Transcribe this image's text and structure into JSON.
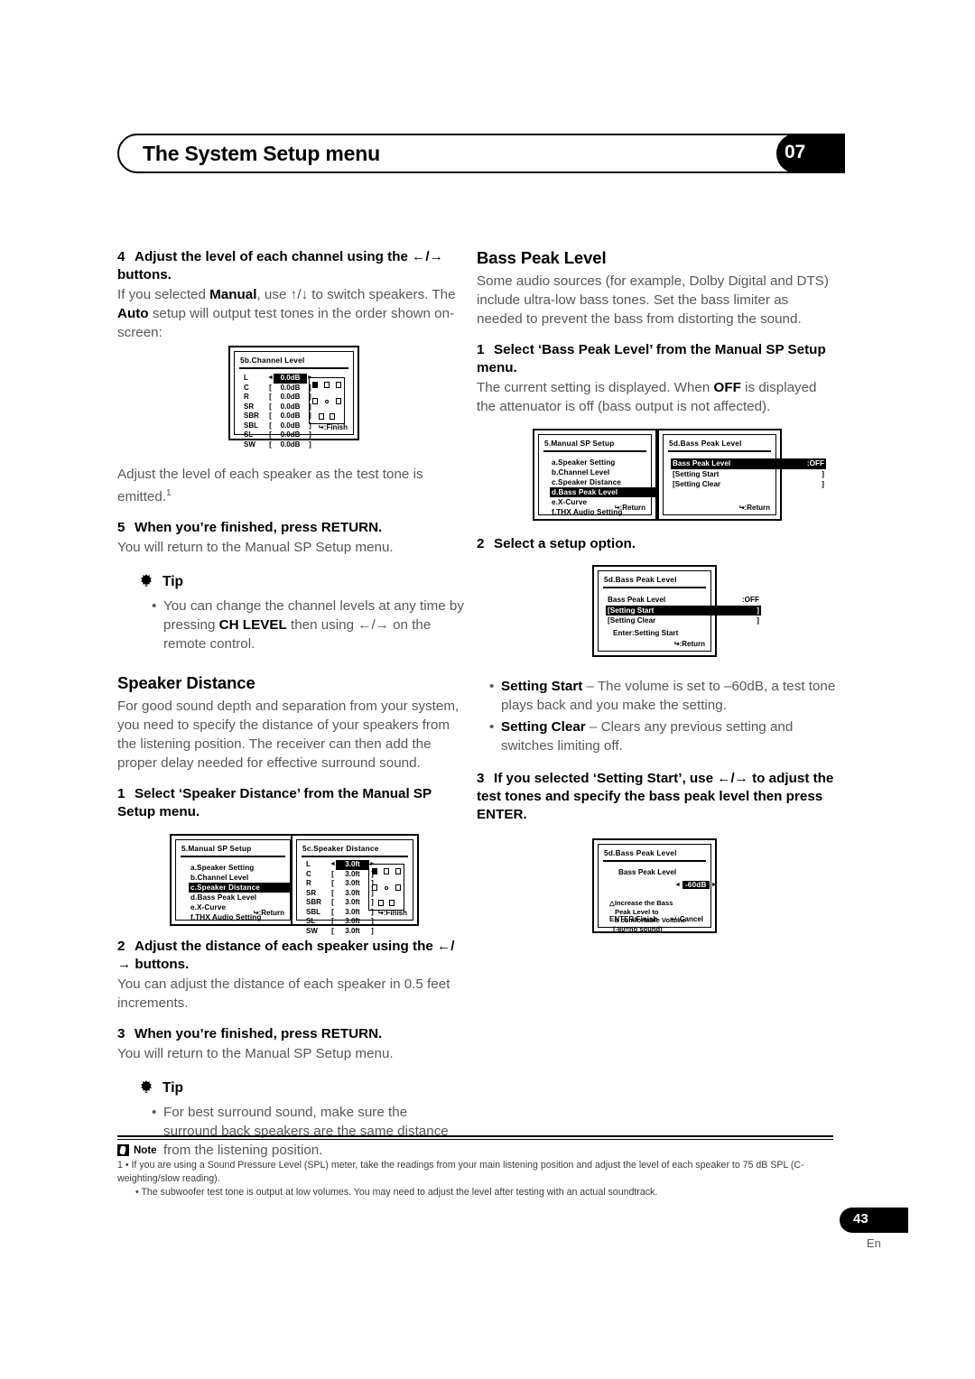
{
  "header": {
    "title": "The System Setup menu",
    "chapter": "07"
  },
  "left_column": {
    "step4": {
      "num": "4",
      "title": "Adjust the level of each channel using the ←/→ buttons.",
      "body_1": "If you selected ",
      "body_manual": "Manual",
      "body_2": ", use ↑/↓ to switch speakers. The ",
      "body_auto": "Auto",
      "body_3": " setup will output test tones in the order shown on-screen:"
    },
    "after_osd_text": "Adjust the level of each speaker as the test tone is emitted.",
    "after_osd_footnote": "1",
    "step5": {
      "num": "5",
      "title": "When you’re finished, press RETURN.",
      "body": "You will return to the Manual SP Setup menu."
    },
    "tip1": {
      "title": "Tip",
      "bullet_a": "You can change the channel levels at any time by pressing ",
      "bullet_b": "CH LEVEL",
      "bullet_c": " then using ←/→ on the remote control."
    },
    "speaker_distance": {
      "heading": "Speaker Distance",
      "body": "For good sound depth and separation from your system, you need to specify the distance of your speakers from the listening position. The receiver can then add the proper delay needed for effective surround sound.",
      "step1_num": "1",
      "step1_title": "Select ‘Speaker Distance’ from the Manual SP Setup menu.",
      "step2_num": "2",
      "step2_title": "Adjust the distance of each speaker using the ←/→ buttons.",
      "step2_body": "You can adjust the distance of each speaker in 0.5 feet increments.",
      "step3_num": "3",
      "step3_title": "When you’re finished, press RETURN.",
      "step3_body": "You will return to the Manual SP Setup menu."
    },
    "tip2": {
      "title": "Tip",
      "bullet": "For best surround sound, make sure the surround back speakers are the same distance from the listening position."
    }
  },
  "right_column": {
    "bass_peak_level": {
      "heading": "Bass Peak Level",
      "body": "Some audio sources (for example, Dolby Digital and DTS) include ultra-low bass tones. Set the bass limiter as needed to prevent the bass from distorting the sound.",
      "step1_num": "1",
      "step1_title": "Select ‘Bass Peak Level’ from the Manual SP Setup menu.",
      "step1_body_a": "The current setting is displayed. When ",
      "step1_body_off": "OFF",
      "step1_body_b": " is displayed the attenuator is off (bass output is not affected).",
      "step2_num": "2",
      "step2_title": "Select a setup option.",
      "bullet_setting_start_k": "Setting Start",
      "bullet_setting_start_t": " – The volume is set to –60dB, a test tone plays back and you make the setting.",
      "bullet_setting_clear_k": "Setting Clear",
      "bullet_setting_clear_t": " – Clears any previous setting and switches limiting off.",
      "step3_num": "3",
      "step3_title": "If you selected ‘Setting Start’, use ←/→ to adjust the test tones and specify the bass peak level then press ENTER."
    }
  },
  "osd_channel_level": {
    "title": "5b.Channel  Level",
    "footer": ":Finish",
    "channels": [
      {
        "name": "L",
        "value": "0.0dB",
        "selected": true
      },
      {
        "name": "C",
        "value": "0.0dB",
        "selected": false
      },
      {
        "name": "R",
        "value": "0.0dB",
        "selected": false
      },
      {
        "name": "SR",
        "value": "0.0dB",
        "selected": false
      },
      {
        "name": "SBR",
        "value": "0.0dB",
        "selected": false
      },
      {
        "name": "SBL",
        "value": "0.0dB",
        "selected": false
      },
      {
        "name": "SL",
        "value": "0.0dB",
        "selected": false
      },
      {
        "name": "SW",
        "value": "0.0dB",
        "selected": false
      }
    ]
  },
  "osd_manual_sp_setup_a": {
    "title": "5.Manual  SP  Setup",
    "footer": ":Return",
    "items": [
      {
        "label": "a.Speaker  Setting",
        "selected": false
      },
      {
        "label": "b.Channel  Level",
        "selected": false
      },
      {
        "label": "c.Speaker  Distance",
        "selected": true
      },
      {
        "label": "d.Bass  Peak  Level",
        "selected": false
      },
      {
        "label": "e.X-Curve",
        "selected": false
      },
      {
        "label": "f.THX  Audio  Setting",
        "selected": false
      }
    ]
  },
  "osd_speaker_distance": {
    "title": "5c.Speaker  Distance",
    "footer": ":Finish",
    "channels": [
      {
        "name": "L",
        "value": "3.0ft",
        "selected": true
      },
      {
        "name": "C",
        "value": "3.0ft",
        "selected": false
      },
      {
        "name": "R",
        "value": "3.0ft",
        "selected": false
      },
      {
        "name": "SR",
        "value": "3.0ft",
        "selected": false
      },
      {
        "name": "SBR",
        "value": "3.0ft",
        "selected": false
      },
      {
        "name": "SBL",
        "value": "3.0ft",
        "selected": false
      },
      {
        "name": "SL",
        "value": "3.0ft",
        "selected": false
      },
      {
        "name": "SW",
        "value": "3.0ft",
        "selected": false
      }
    ]
  },
  "osd_manual_sp_setup_b": {
    "title": "5.Manual  SP  Setup",
    "footer": ":Return",
    "items": [
      {
        "label": "a.Speaker  Setting",
        "selected": false
      },
      {
        "label": "b.Channel  Level",
        "selected": false
      },
      {
        "label": "c.Speaker  Distance",
        "selected": false
      },
      {
        "label": "d.Bass  Peak  Level",
        "selected": true
      },
      {
        "label": "e.X-Curve",
        "selected": false
      },
      {
        "label": "f.THX  Audio  Setting",
        "selected": false
      }
    ]
  },
  "osd_bass_peak_a": {
    "title": "5d.Bass  Peak  Level",
    "footer": ":Return",
    "rows": [
      {
        "label": "Bass  Peak  Level",
        "value": ":OFF",
        "selected": true
      },
      {
        "label": "[Setting  Start",
        "value": "]",
        "selected": false
      },
      {
        "label": "[Setting  Clear",
        "value": "]",
        "selected": false
      }
    ]
  },
  "osd_bass_peak_b": {
    "title": "5d.Bass  Peak  Level",
    "footer": ":Return",
    "rows": [
      {
        "label": "Bass  Peak  Level",
        "value": ":OFF",
        "selected": false
      },
      {
        "label": "[Setting  Start",
        "value": "]",
        "selected": true
      },
      {
        "label": "[Setting  Clear",
        "value": "]",
        "selected": false
      }
    ],
    "hint": "Enter:Setting  Start"
  },
  "osd_bass_peak_c": {
    "title": "5d.Bass  Peak  Level",
    "label": "Bass  Peak  Level",
    "value": "-60dB",
    "note_line1": "Increase  the  Bass",
    "note_line2": "Peak  Level  to",
    "note_line3": "a  comfortable  Volume",
    "note_line4": "(-80=no  sound)",
    "foot_left": "ENTER:Finish",
    "foot_right": ":Cancel"
  },
  "note": {
    "title": "Note",
    "item1": "1 • If you are using a Sound Pressure Level (SPL) meter, take the readings from your main listening position and adjust the level of each speaker to 75 dB SPL (C-weighting/slow reading).",
    "item2": "• The subwoofer test tone is output at low volumes. You may need to adjust the level after testing with an actual soundtrack."
  },
  "footer": {
    "page": "43",
    "lang": "En"
  }
}
